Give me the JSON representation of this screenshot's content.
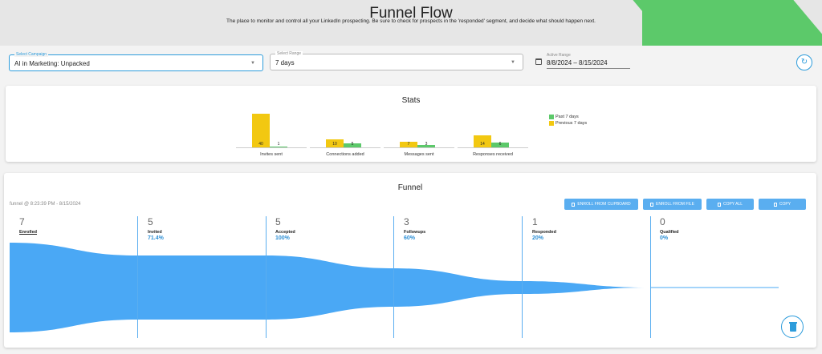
{
  "header": {
    "title": "Funnel Flow",
    "subtitle": "The place to monitor and control all your LinkedIn prospecting. Be sure to check for prospects in the 'responded' segment, and decide what should happen next.",
    "accent_color": "#5cc96a"
  },
  "controls": {
    "campaign_label": "Select Campaign",
    "campaign_value": "AI in Marketing: Unpacked",
    "range_label": "Select Range",
    "range_value": "7 days",
    "active_range_label": "Active Range",
    "active_range_value": "8/8/2024 – 8/15/2024",
    "refresh_icon": "refresh-icon"
  },
  "stats": {
    "title": "Stats",
    "legend": [
      "Past 7 days",
      "Previous 7 days"
    ],
    "colors": {
      "past": "#5cc96a",
      "previous": "#f2c811"
    }
  },
  "chart_data": {
    "type": "bar",
    "title": "Stats",
    "categories": [
      "Invites sent",
      "Connections added",
      "Messages sent",
      "Responses received"
    ],
    "series": [
      {
        "name": "Previous 7 days",
        "values": [
          40,
          10,
          7,
          14
        ]
      },
      {
        "name": "Past 7 days",
        "values": [
          1,
          5,
          3,
          6
        ]
      }
    ],
    "ylim": [
      0,
      40
    ],
    "grid": false,
    "legend_position": "right"
  },
  "funnel": {
    "title": "Funnel",
    "timestamp": "funnel @ 8:23:39 PM - 8/15/2024",
    "buttons": [
      "ENROLL FROM CLIPBOARD",
      "ENROLL FROM FILE",
      "COPY ALL",
      "COPY"
    ],
    "stages": [
      {
        "count": "7",
        "name": "Enrolled",
        "pct": ""
      },
      {
        "count": "5",
        "name": "Invited",
        "pct": "71.4%"
      },
      {
        "count": "5",
        "name": "Accepted",
        "pct": "100%"
      },
      {
        "count": "3",
        "name": "Followups",
        "pct": "60%"
      },
      {
        "count": "1",
        "name": "Responded",
        "pct": "20%"
      },
      {
        "count": "0",
        "name": "Qualified",
        "pct": "0%"
      }
    ],
    "stage_values": [
      7,
      5,
      5,
      3,
      1,
      0
    ],
    "flow_color": "#4aa8f5",
    "delete_icon": "trash-icon"
  }
}
